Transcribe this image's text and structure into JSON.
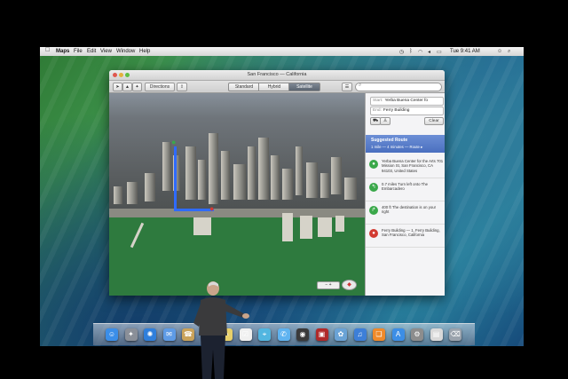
{
  "menubar": {
    "apple": "",
    "items": [
      "Maps",
      "File",
      "Edit",
      "View",
      "Window",
      "Help"
    ],
    "clock": "Tue 9:41 AM"
  },
  "window": {
    "title": "San Francisco — California",
    "toolbar": {
      "directions_label": "Directions",
      "segments": [
        "Standard",
        "Hybrid",
        "Satellite"
      ],
      "active_segment": "Satellite"
    }
  },
  "directions": {
    "start_label": "Start:",
    "start_value": "Yerba Buena Center fo",
    "end_label": "End:",
    "end_value": "Ferry Building",
    "clear_label": "Clear",
    "suggested_title": "Suggested Route",
    "suggested_sub": "1 mile — 4 minutes — Route ▸",
    "steps": [
      {
        "icon": "start-pin-icon",
        "color": "#3aa84a",
        "text": "Yerba Buena Center for the Arts 701 Mission St, San Francisco, CA 94103, United States"
      },
      {
        "icon": "arrow-icon",
        "color": "#3aa84a",
        "text": "0.7 miles Turn left onto The Embarcadero"
      },
      {
        "icon": "arrow-icon",
        "color": "#3aa84a",
        "text": "400 ft The destination is on your right"
      },
      {
        "icon": "end-pin-icon",
        "color": "#d23b32",
        "text": "Ferry Building — 1, Ferry Building, San Francisco, California"
      }
    ]
  },
  "dock": {
    "apps": [
      {
        "name": "finder-icon",
        "color": "#3b8ee8",
        "glyph": "☺"
      },
      {
        "name": "launchpad-icon",
        "color": "#8a8f98",
        "glyph": "✦"
      },
      {
        "name": "safari-icon",
        "color": "#2f7fdc",
        "glyph": "✺"
      },
      {
        "name": "mail-icon",
        "color": "#5e9be6",
        "glyph": "✉"
      },
      {
        "name": "contacts-icon",
        "color": "#c9a25a",
        "glyph": "☎"
      },
      {
        "name": "calendar-icon",
        "color": "#e9e9e9",
        "glyph": "▦"
      },
      {
        "name": "notes-icon",
        "color": "#e8d06a",
        "glyph": "✎"
      },
      {
        "name": "reminders-icon",
        "color": "#f0f0f0",
        "glyph": "☑"
      },
      {
        "name": "maps-icon",
        "color": "#52b6e0",
        "glyph": "⌖"
      },
      {
        "name": "messages-icon",
        "color": "#5fb3f0",
        "glyph": "✆"
      },
      {
        "name": "facetime-icon",
        "color": "#3a3a3a",
        "glyph": "◉"
      },
      {
        "name": "photobooth-icon",
        "color": "#b02a2a",
        "glyph": "▣"
      },
      {
        "name": "iphoto-icon",
        "color": "#6aa3d6",
        "glyph": "✿"
      },
      {
        "name": "itunes-icon",
        "color": "#3d7fd8",
        "glyph": "♫"
      },
      {
        "name": "ibooks-icon",
        "color": "#f08a2a",
        "glyph": "❑"
      },
      {
        "name": "appstore-icon",
        "color": "#3c8ee6",
        "glyph": "A"
      },
      {
        "name": "preferences-icon",
        "color": "#8d8d8d",
        "glyph": "⚙"
      },
      {
        "name": "documents-icon",
        "color": "#d9d9d9",
        "glyph": "▤"
      },
      {
        "name": "trash-icon",
        "color": "#9aa3ad",
        "glyph": "⌫"
      }
    ]
  },
  "colors": {
    "route": "#2f6bff",
    "selected_row": "#4a6fbf",
    "start_pin": "#3aa84a",
    "end_pin": "#d23b32"
  }
}
